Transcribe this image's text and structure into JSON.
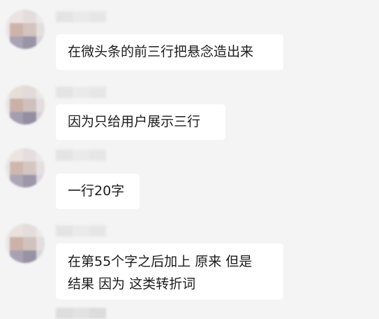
{
  "messages": [
    {
      "lines": [
        "在微头条的前三行把悬念造出来"
      ]
    },
    {
      "lines": [
        "因为只给用户展示三行"
      ]
    },
    {
      "lines": [
        "一行20字"
      ]
    },
    {
      "lines": [
        "在第55个字之后加上 原来 但是",
        "结果 因为 这类转折词"
      ]
    }
  ]
}
